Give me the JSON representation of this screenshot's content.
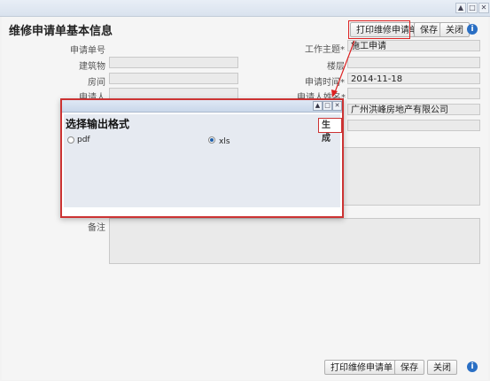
{
  "window": {
    "minimize_glyph": "▲",
    "maximize_glyph": "□",
    "close_glyph": "✕"
  },
  "form": {
    "title": "维修申请单基本信息",
    "toolbar": {
      "print_label": "打印维修申请单",
      "save_label": "保存",
      "close_label": "关闭",
      "help_glyph": "i"
    },
    "left_labels": [
      "申请单号",
      "建筑物",
      "房间",
      "申请人"
    ],
    "right_fields": [
      {
        "label": "工作主题*",
        "value": "施工申请"
      },
      {
        "label": "楼层",
        "value": ""
      },
      {
        "label": "申请时间*",
        "value": "2014-11-18"
      },
      {
        "label": "申请人姓名*",
        "value": ""
      },
      {
        "label": "",
        "value": "广州洪峰房地产有限公司"
      }
    ],
    "remarks_label": "备注",
    "bottom_toolbar": {
      "print_label": "打印维修申请单",
      "save_label": "保存",
      "close_label": "关闭"
    }
  },
  "dialog": {
    "heading": "选择输出格式",
    "generate_label": "生成",
    "options": [
      {
        "label": "pdf",
        "selected": false
      },
      {
        "label": "xls",
        "selected": true
      }
    ],
    "minimize_glyph": "▲",
    "maximize_glyph": "□",
    "close_glyph": "✕"
  },
  "colors": {
    "highlight": "#dd2222",
    "accent": "#1f5faa"
  }
}
